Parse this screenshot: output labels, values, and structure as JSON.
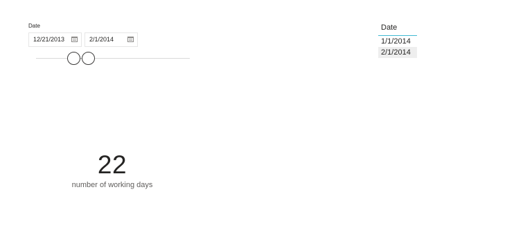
{
  "slicer": {
    "header": "Date",
    "start_date": "12/21/2013",
    "end_date": "2/1/2014",
    "icons": [
      "calendar-icon",
      "calendar-icon"
    ]
  },
  "table": {
    "header": "Date",
    "rows": [
      "1/1/2014",
      "2/1/2014"
    ],
    "accent_color": "#3fb8d2"
  },
  "card": {
    "value": "22",
    "label": "number of working days"
  }
}
